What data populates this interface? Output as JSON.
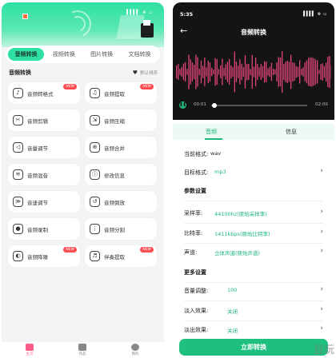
{
  "left": {
    "status": "▌▌▌▌ ⊛ ▭",
    "tabs": [
      {
        "label": "音频转换",
        "active": true
      },
      {
        "label": "视频转换",
        "active": false
      },
      {
        "label": "图片转换",
        "active": false
      },
      {
        "label": "文档转换",
        "active": false
      }
    ],
    "section_title": "音频转换",
    "sort_label": "默认排序",
    "tools": [
      {
        "label": "音频转格式",
        "icon": "music-file-icon",
        "new": true
      },
      {
        "label": "音频提取",
        "icon": "music-extract-icon",
        "new": true
      },
      {
        "label": "音频剪辑",
        "icon": "scissors-icon",
        "new": false
      },
      {
        "label": "音频压缩",
        "icon": "compress-icon",
        "new": false
      },
      {
        "label": "音量调节",
        "icon": "volume-icon",
        "new": false
      },
      {
        "label": "音频合并",
        "icon": "merge-icon",
        "new": false
      },
      {
        "label": "音频混音",
        "icon": "mix-icon",
        "new": false
      },
      {
        "label": "修改信息",
        "icon": "info-edit-icon",
        "new": false
      },
      {
        "label": "音速调节",
        "icon": "speed-icon",
        "new": false
      },
      {
        "label": "音频倒放",
        "icon": "reverse-icon",
        "new": false
      },
      {
        "label": "音频录制",
        "icon": "record-icon",
        "new": false
      },
      {
        "label": "音频分割",
        "icon": "split-icon",
        "new": false
      },
      {
        "label": "音频降噪",
        "icon": "denoise-icon",
        "new": true
      },
      {
        "label": "伴奏提取",
        "icon": "accompaniment-icon",
        "new": true
      }
    ],
    "new_badge": "NEW",
    "nav": [
      {
        "label": "主页",
        "icon": "home-icon",
        "active": true
      },
      {
        "label": "作品",
        "icon": "works-icon",
        "active": false
      },
      {
        "label": "我的",
        "icon": "profile-icon",
        "active": false
      }
    ]
  },
  "right": {
    "time": "5:35",
    "status": "▌▌▌▌ ⊛ ▭",
    "title": "音频转换",
    "time_start": "00:01",
    "time_end": "02:00",
    "tabs": [
      {
        "label": "音频",
        "active": true
      },
      {
        "label": "信息",
        "active": false
      }
    ],
    "current_format_label": "当前格式:",
    "current_format_value": "wav",
    "target_format_label": "目标格式:",
    "target_format_value": "mp3",
    "param_group": "参数设置",
    "sample_rate_label": "采样率:",
    "sample_rate_value": "44100hz(原始采样率)",
    "bitrate_label": "比特率:",
    "bitrate_value": "1411kbps(原始比特率)",
    "channel_label": "声道:",
    "channel_value": "立体声道(原始声道)",
    "more_group": "更多设置",
    "volume_label": "音量调整:",
    "volume_value": "100",
    "fade_in_label": "淡入效果:",
    "fade_in_value": "关闭",
    "fade_out_label": "淡出效果:",
    "fade_out_value": "关闭",
    "convert_button": "立即转换",
    "playback_progress": 0.01
  },
  "watermark": "豆玩",
  "colors": {
    "accent_green": "#2ee0a1",
    "button_green": "#1fc07f",
    "wave_pink": "#e0457a",
    "badge_red": "#ff4d4f"
  }
}
